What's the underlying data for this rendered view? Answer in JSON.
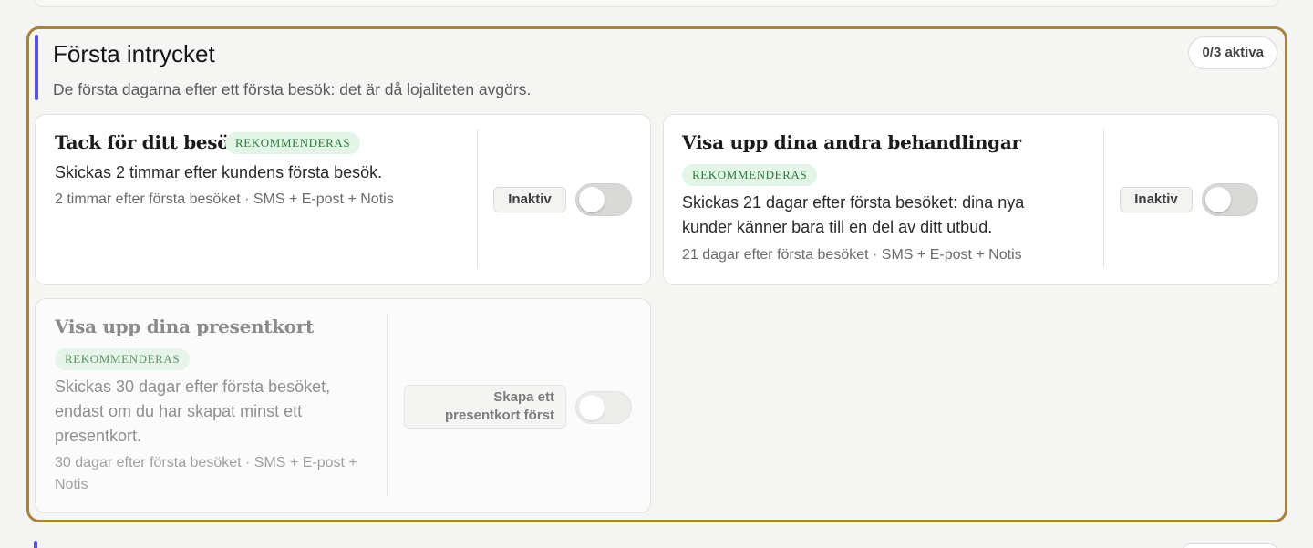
{
  "section": {
    "title": "Första intrycket",
    "subtitle": "De första dagarna efter ett första besök: det är då lojaliteten avgörs.",
    "active_count": "0/3 aktiva"
  },
  "cards": [
    {
      "title": "Tack för ditt besök!",
      "badge": "REKOMMENDERAS",
      "description": "Skickas 2 timmar efter kundens första besök.",
      "meta": "2 timmar efter första besöket · SMS + E-post + Notis",
      "status": "Inaktiv",
      "enabled": false
    },
    {
      "title": "Visa upp dina andra behandlingar",
      "badge": "REKOMMENDERAS",
      "description": "Skickas 21 dagar efter första besöket: dina nya kunder känner bara till en del av ditt utbud.",
      "meta": "21 dagar efter första besöket · SMS + E-post + Notis",
      "status": "Inaktiv",
      "enabled": false
    },
    {
      "title": "Visa upp dina presentkort",
      "badge": "REKOMMENDERAS",
      "description": "Skickas 30 dagar efter första besöket, endast om du har skapat minst ett presentkort.",
      "meta": "30 dagar efter första besöket · SMS + E-post + Notis",
      "status": "Skapa ett presentkort först",
      "enabled": false
    }
  ],
  "colors": {
    "accent_border": "#a9823e",
    "accent_bar": "#5a52d9",
    "badge_bg": "#e2f5e6",
    "badge_text": "#2f7a3c"
  }
}
